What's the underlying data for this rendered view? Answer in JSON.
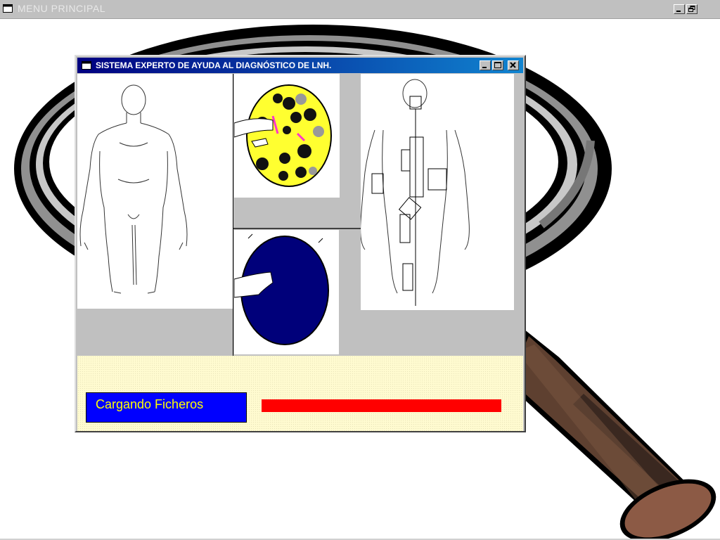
{
  "main_window": {
    "title": "MENU PRINCIPAL",
    "icon": "app-window-icon",
    "controls": [
      "minimize-button",
      "restore-button"
    ]
  },
  "backdrop": {
    "image": "magnifying-glass-illustration",
    "colors": {
      "lens_rim_dark": "#000000",
      "lens_rim_gray": "#808080",
      "handle_brown": "#5e4030",
      "handle_end": "#8c5a45"
    }
  },
  "dialog": {
    "title": "SISTEMA EXPERTO DE AYUDA AL DIAGNÓSTICO DE LNH.",
    "controls": [
      "minimize-button",
      "maximize-button",
      "close-button"
    ],
    "images": [
      {
        "name": "human-body-front-outline"
      },
      {
        "name": "lymph-node-cells-yellow"
      },
      {
        "name": "lymph-node-blue"
      },
      {
        "name": "human-body-organ-map"
      }
    ],
    "status": {
      "label": "Cargando Ficheros",
      "box_color": "#0000ff",
      "text_color": "#ffff00"
    },
    "progress": {
      "fraction": 1.0,
      "color": "#ff0000"
    }
  }
}
